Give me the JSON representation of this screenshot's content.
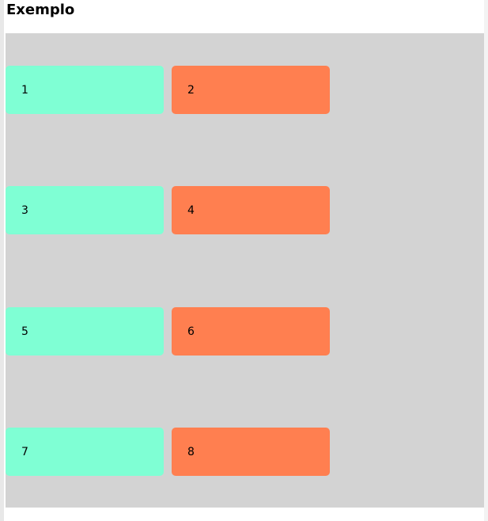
{
  "page": {
    "title": "Exemplo"
  },
  "colors": {
    "container": "#d3d3d3",
    "aquamarine": "#7fffd4",
    "coral": "#ff7f50"
  },
  "boxes": [
    {
      "label": "1",
      "color": "#7fffd4"
    },
    {
      "label": "2",
      "color": "#ff7f50"
    },
    {
      "label": "3",
      "color": "#7fffd4"
    },
    {
      "label": "4",
      "color": "#ff7f50"
    },
    {
      "label": "5",
      "color": "#7fffd4"
    },
    {
      "label": "6",
      "color": "#ff7f50"
    },
    {
      "label": "7",
      "color": "#7fffd4"
    },
    {
      "label": "8",
      "color": "#ff7f50"
    }
  ]
}
